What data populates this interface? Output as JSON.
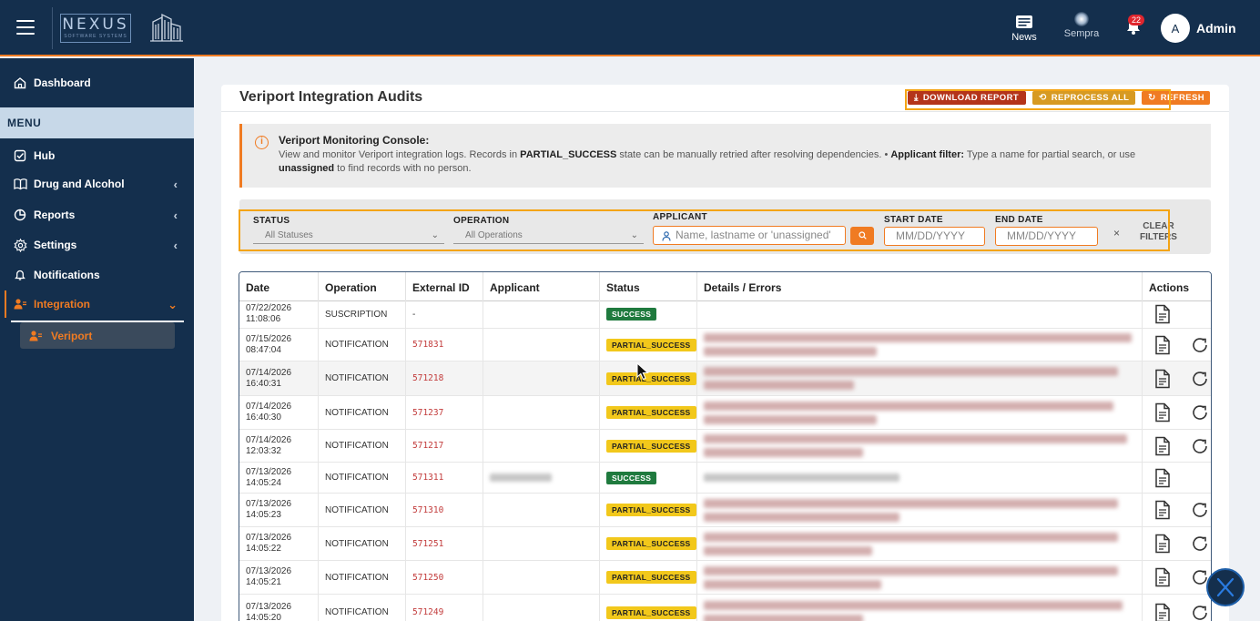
{
  "app": {
    "logo_text": "NEXUS",
    "logo_sub": "SOFTWARE SYSTEMS"
  },
  "topbar": {
    "news_label": "News",
    "sempra_label": "Sempra",
    "notif_count": "22",
    "avatar_initial": "A",
    "user_name": "Admin"
  },
  "sidebar": {
    "dashboard": "Dashboard",
    "menu_header": "MENU",
    "items": [
      {
        "label": "Hub",
        "icon": "checkbox-icon"
      },
      {
        "label": "Drug and Alcohol",
        "icon": "book-icon"
      },
      {
        "label": "Reports",
        "icon": "pie-chart-icon"
      },
      {
        "label": "Settings",
        "icon": "gear-icon"
      },
      {
        "label": "Notifications",
        "icon": "bell-icon"
      },
      {
        "label": "Integration",
        "icon": "user-edit-icon"
      }
    ],
    "sub_item": "Veriport"
  },
  "page": {
    "title": "Veriport Integration Audits",
    "buttons": {
      "download": "DOWNLOAD REPORT",
      "reprocess": "REPROCESS ALL",
      "refresh": "REFRESH"
    }
  },
  "info": {
    "title": "Veriport Monitoring Console:",
    "line1_a": "View and monitor Veriport integration logs. Records in ",
    "line1_b": "PARTIAL_SUCCESS",
    "line1_c": " state can be manually retried after resolving dependencies.  •  ",
    "line1_d": "Applicant filter:",
    "line1_e": " Type a name for partial search, or use",
    "line2_a": "unassigned",
    "line2_b": " to find records with no person."
  },
  "filters": {
    "status_label": "STATUS",
    "status_value": "All Statuses",
    "operation_label": "OPERATION",
    "operation_value": "All Operations",
    "applicant_label": "APPLICANT",
    "applicant_placeholder": "Name, lastname or 'unassigned'",
    "start_label": "START DATE",
    "start_placeholder": "MM/DD/YYYY",
    "end_label": "END DATE",
    "end_placeholder": "MM/DD/YYYY",
    "clear_x": "×",
    "clear_line1": "CLEAR",
    "clear_line2": "FILTERS"
  },
  "table": {
    "headers": [
      "Date",
      "Operation",
      "External ID",
      "Applicant",
      "Status",
      "Details / Errors",
      "Actions"
    ],
    "rows": [
      {
        "date": "07/22/2026",
        "time": "11:08:06",
        "operation": "SUSCRIPTION",
        "external_id": "-",
        "status": "SUCCESS",
        "retry": false
      },
      {
        "date": "07/15/2026",
        "time": "08:47:04",
        "operation": "NOTIFICATION",
        "external_id": "571831",
        "status": "PARTIAL_SUCCESS",
        "retry": true
      },
      {
        "date": "07/14/2026",
        "time": "16:40:31",
        "operation": "NOTIFICATION",
        "external_id": "571218",
        "status": "PARTIAL_SUCCESS",
        "retry": true
      },
      {
        "date": "07/14/2026",
        "time": "16:40:30",
        "operation": "NOTIFICATION",
        "external_id": "571237",
        "status": "PARTIAL_SUCCESS",
        "retry": true
      },
      {
        "date": "07/14/2026",
        "time": "12:03:32",
        "operation": "NOTIFICATION",
        "external_id": "571217",
        "status": "PARTIAL_SUCCESS",
        "retry": true
      },
      {
        "date": "07/13/2026",
        "time": "14:05:24",
        "operation": "NOTIFICATION",
        "external_id": "571311",
        "status": "SUCCESS",
        "retry": false
      },
      {
        "date": "07/13/2026",
        "time": "14:05:23",
        "operation": "NOTIFICATION",
        "external_id": "571310",
        "status": "PARTIAL_SUCCESS",
        "retry": true
      },
      {
        "date": "07/13/2026",
        "time": "14:05:22",
        "operation": "NOTIFICATION",
        "external_id": "571251",
        "status": "PARTIAL_SUCCESS",
        "retry": true
      },
      {
        "date": "07/13/2026",
        "time": "14:05:21",
        "operation": "NOTIFICATION",
        "external_id": "571250",
        "status": "PARTIAL_SUCCESS",
        "retry": true
      },
      {
        "date": "07/13/2026",
        "time": "14:05:20",
        "operation": "NOTIFICATION",
        "external_id": "571249",
        "status": "PARTIAL_SUCCESS",
        "retry": true
      }
    ]
  },
  "colors": {
    "navy": "#142f4d",
    "accent_orange": "#f07b22",
    "partial_badge": "#f2c81b",
    "success_badge": "#1f7a3e",
    "external_id": "#c23b3b"
  }
}
